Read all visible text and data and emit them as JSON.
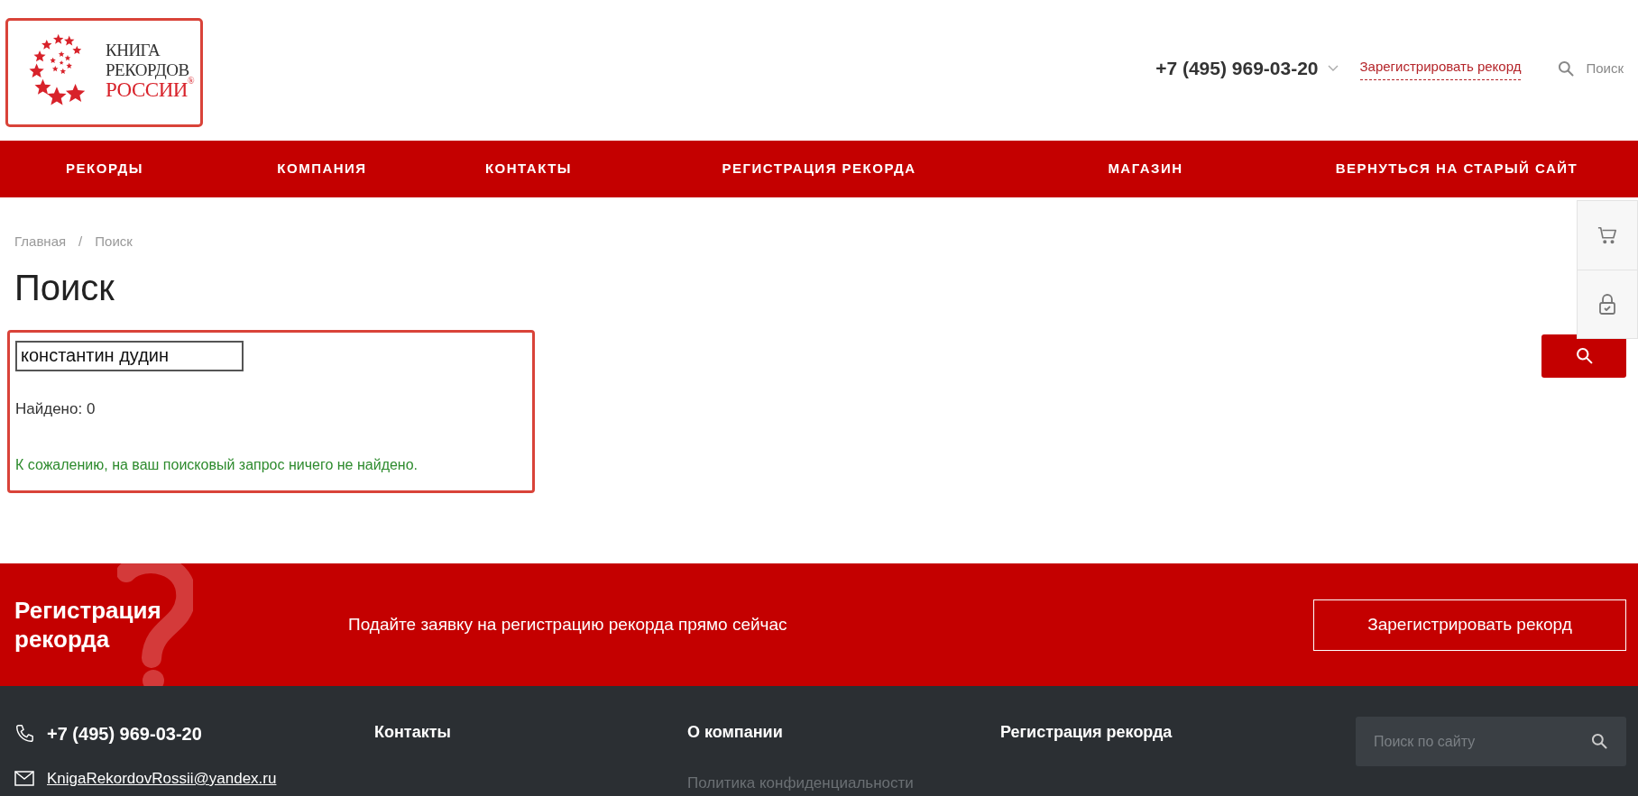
{
  "logo": {
    "lines": [
      "КНИГА",
      "РЕКОРДОВ",
      "РОССИИ"
    ],
    "mark": "®"
  },
  "header": {
    "phone": "+7 (495) 969-03-20",
    "register_link": "Зарегистрировать рекорд",
    "search_label": "Поиск"
  },
  "nav": [
    {
      "label": "РЕКОРДЫ"
    },
    {
      "label": "КОМПАНИЯ"
    },
    {
      "label": "КОНТАКТЫ"
    },
    {
      "label": "РЕГИСТРАЦИЯ РЕКОРДА"
    },
    {
      "label": "МАГАЗИН"
    },
    {
      "label": "ВЕРНУТЬСЯ НА СТАРЫЙ САЙТ"
    }
  ],
  "breadcrumbs": [
    {
      "label": "Главная"
    },
    {
      "label": "Поиск"
    }
  ],
  "breadcrumb_separator": "/",
  "title": "Поиск",
  "search": {
    "value": "константин дудин",
    "found": "Найдено: 0",
    "message": "К сожалению, на ваш поисковый запрос ничего не найдено."
  },
  "side_panel": [
    {
      "kind": "cart"
    },
    {
      "kind": "lock"
    }
  ],
  "cta": {
    "title": "Регистрация рекорда",
    "text": "Подайте заявку на регистрацию рекорда прямо сейчас",
    "button": "Зарегистрировать рекорд"
  },
  "footer": {
    "phone": "+7 (495) 969-03-20",
    "email": "KnigaRekordovRossii@yandex.ru",
    "columns": [
      {
        "title": "Контакты"
      },
      {
        "title": "О компании",
        "links": [
          "Политика конфиденциальности"
        ]
      },
      {
        "title": "Регистрация рекорда"
      }
    ],
    "search_placeholder": "Поиск по сайту"
  }
}
